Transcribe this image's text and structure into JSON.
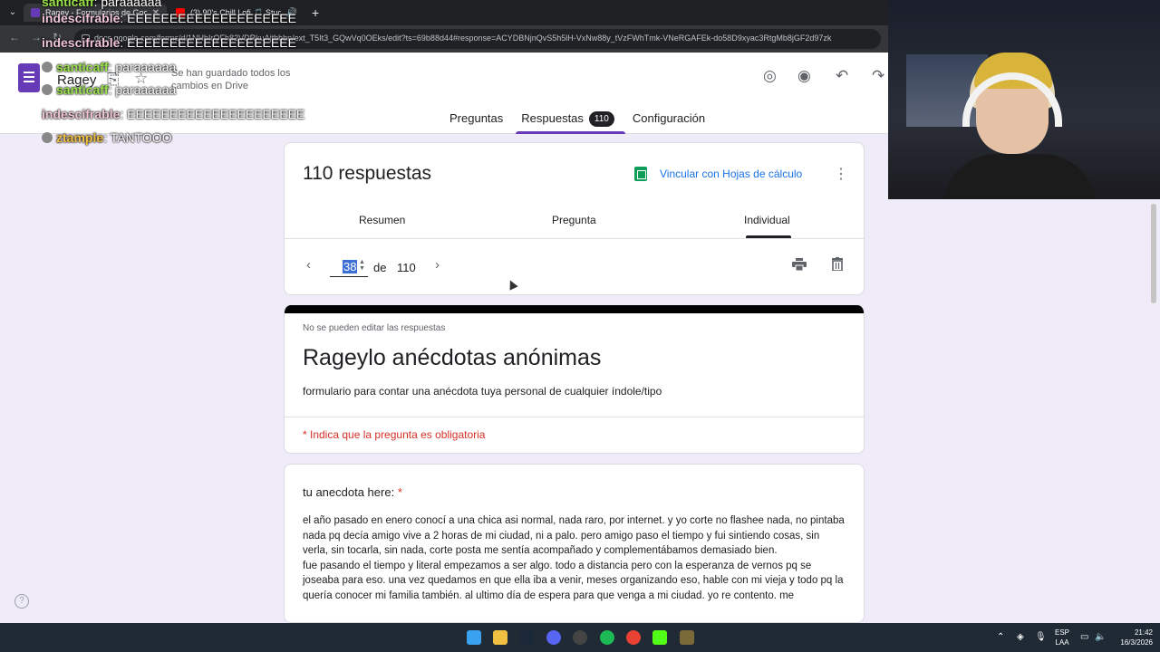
{
  "browser": {
    "tabs": [
      {
        "title": "Ragey - Formularios de Google",
        "color": "#673ab7"
      },
      {
        "title": "(3) 90's Chill Lofi 🎵 Study",
        "color": "#ff0000"
      }
    ],
    "url": "docs.google.com/forms/d/1NHbIrQFh82VDRkuAjtbbbn/ext_T5It3_GQwVq0OEks/edit?ts=69b88d44#response=ACYDBNjnQvS5h5lH-VxNw88y_tVzFWhTmk-VNeRGAFEk-do58D9xyac3RtgMb8jGF2d97zk"
  },
  "forms_header": {
    "doc_title": "Ragey",
    "saved_status": "Se han guardado todos los cambios en Drive",
    "tabs": [
      {
        "label": "Preguntas"
      },
      {
        "label": "Respuestas",
        "badge": "110"
      },
      {
        "label": "Configuración"
      }
    ]
  },
  "summary": {
    "count_text": "110 respuestas",
    "sheets_link": "Vincular con Hojas de cálculo",
    "sub_tabs": [
      "Resumen",
      "Pregunta",
      "Individual"
    ],
    "current": "38",
    "de": "de",
    "total": "110"
  },
  "form": {
    "no_edit": "No se pueden editar las respuestas",
    "title": "Rageylo anécdotas anónimas",
    "description": "formulario para contar una anécdota tuya personal de cualquier índole/tipo",
    "required_note": "* Indica que la pregunta es obligatoria"
  },
  "answer": {
    "question": "tu anecdota here: ",
    "star": "*",
    "text": "el año pasado en enero conocí a una chica asi normal, nada raro, por internet. y yo corte no flashee nada, no pintaba nada pq decía amigo vive a 2 horas de mi ciudad, ni a palo. pero amigo paso el tiempo y fui sintiendo cosas, sin verla, sin tocarla, sin nada, corte posta me sentía acompañado y complementábamos demasiado bien.\nfue pasando el tiempo y literal empezamos a ser algo. todo a distancia pero con la esperanza de vernos pq se joseaba para eso. una vez quedamos en que ella iba a venir, meses organizando eso, hable con mi vieja y todo pq la quería conocer mi familia también. al ultimo día de espera para que venga a mi ciudad. yo re contento. me"
  },
  "chat": [
    {
      "user": "santicaff",
      "msg": ": paraaaaaa",
      "style": "g"
    },
    {
      "user": "indescifrable",
      "msg": ": EEEEEEEEEEEEEEEEEEEE",
      "style": "p"
    },
    {
      "user": "indescifrable",
      "msg": ": EEEEEEEEEEEEEEEEEEEE",
      "style": "p"
    },
    {
      "user": "santicaff",
      "msg": ": paraaaaaa",
      "style": "g"
    },
    {
      "user": "santicaff",
      "msg": ": paraaaaaa",
      "style": "g"
    },
    {
      "user": "indescifrable",
      "msg": ": EEEEEEEEEEEEEEEEEEEEE",
      "style": "p"
    },
    {
      "user": "ztample",
      "msg": ": TANTOOO",
      "style": "y"
    }
  ],
  "taskbar": {
    "lang_1": "ESP",
    "lang_2": "LAA",
    "time": "21:42",
    "date": "16/3/2026"
  },
  "colors": {
    "forms_purple": "#673ab7",
    "link_blue": "#1a73e8",
    "required_red": "#d93025",
    "canvas_bg": "#f0ebf8"
  }
}
